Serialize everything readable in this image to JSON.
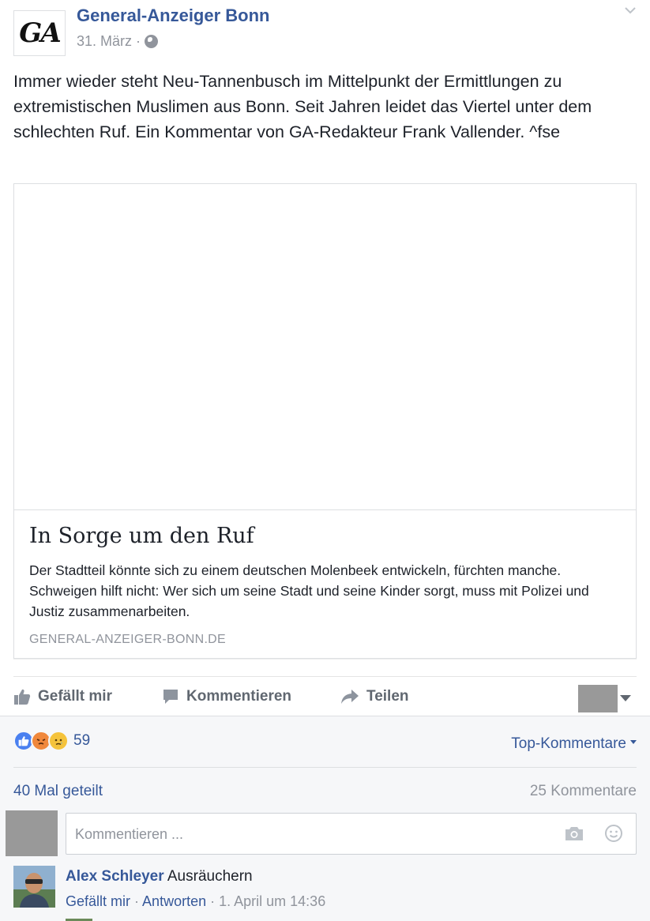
{
  "post": {
    "page_name": "General-Anzeiger Bonn",
    "page_logo_text": "GA",
    "date": "31. März",
    "separator": "·",
    "privacy_icon": "globe-icon",
    "text": "Immer wieder steht Neu-Tannenbusch im Mittelpunkt der Ermittlungen zu extremistischen Muslimen aus Bonn. Seit Jahren leidet das Viertel unter dem schlechten Ruf. Ein Kommentar von GA-Redakteur Frank Vallender. ^fse"
  },
  "link_card": {
    "title": "In Sorge um den Ruf",
    "description": "Der Stadtteil könnte sich zu einem deutschen Molenbeek entwickeln, fürchten manche. Schweigen hilft nicht: Wer sich um seine Stadt und seine Kinder sorgt, muss mit Polizei und Justiz zusammenarbeiten.",
    "domain": "GENERAL-ANZEIGER-BONN.DE"
  },
  "actions": {
    "like": "Gefällt mir",
    "comment": "Kommentieren",
    "share": "Teilen",
    "icons": [
      "thumbs-up-icon",
      "comment-bubble-icon",
      "share-arrow-icon"
    ]
  },
  "feedback": {
    "reaction_icons": [
      "like-reaction-icon",
      "angry-reaction-icon",
      "sad-reaction-icon"
    ],
    "reaction_count": "59",
    "sort_label": "Top-Kommentare",
    "shares": "40 Mal geteilt",
    "comments": "25 Kommentare"
  },
  "composer": {
    "placeholder": "Kommentieren ..."
  },
  "comment": {
    "author": "Alex Schleyer",
    "text": "Ausräuchern",
    "like": "Gefällt mir",
    "reply": "Antworten",
    "timestamp": "1. April um 14:36",
    "separator": "·"
  },
  "colors": {
    "link_blue": "#365899",
    "meta_grey": "#90949c",
    "action_grey": "#606770",
    "feedback_bg": "#f6f7f9"
  }
}
